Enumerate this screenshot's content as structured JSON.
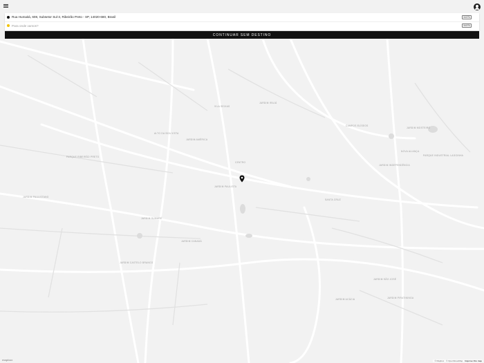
{
  "header": {
    "menu_icon": "hamburger-menu-icon",
    "profile_icon": "user-profile-icon"
  },
  "trip": {
    "origin": "Rua Humaitá, 608, Subsetor Sul-3, Ribeirão Preto - SP, 14020-680, Brasil",
    "destination_placeholder": "Para onde vamos?",
    "map_chip_label": "MAPA",
    "continue_button": "CONTINUAR SEM DESTINO"
  },
  "map": {
    "labels": [
      "PARQUE RIBEIRÃO PRETO",
      "JARDIM PAULISTANO",
      "JARDIM CASTELO BRANCO",
      "ALTO DA BOA VISTA",
      "JARDIM AMÉRICA",
      "JARDIM SUMARÉ",
      "VILA SEIXAS",
      "CENTRO",
      "JARDIM PAULISTA",
      "JARDIM IRAJÁ",
      "PARQUE INDUSTRIAL LAGOINHA",
      "CAMPOS ELÍSEOS",
      "JARDIM MOSTEIRO",
      "JARDIM SÃO JOSÉ",
      "SANTA CRUZ",
      "JARDIM CANADÁ",
      "NOVA ALIANÇA",
      "JARDIM INDEPENDÊNCIA",
      "JARDIM ACÁCIA",
      "JARDIM PIRATININGA"
    ]
  },
  "attribution": {
    "logo": "mapbox",
    "items": [
      "© Mapbox",
      "© OpenStreetMap",
      "Improve this map"
    ]
  }
}
